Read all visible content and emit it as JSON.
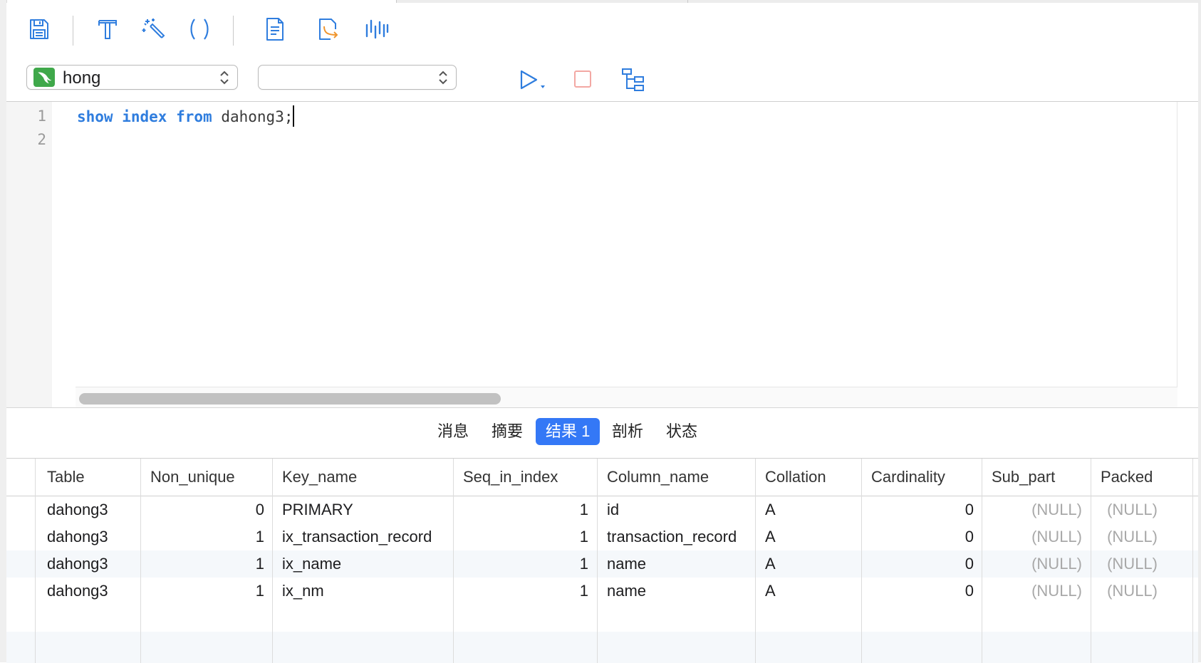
{
  "toolbar": {
    "icons": [
      "save-icon",
      "format-icon",
      "magic-wand-icon",
      "parentheses-icon",
      "document-icon",
      "export-icon",
      "profile-chart-icon"
    ],
    "connection": {
      "value": "hong",
      "icon": "mysql-dolphin-icon"
    },
    "database": {
      "value": ""
    },
    "run_icon": "play-icon",
    "stop_icon": "stop-icon",
    "explain_icon": "explain-tree-icon"
  },
  "editor": {
    "line_numbers": [
      "1",
      "2"
    ],
    "tokens": [
      {
        "text": "show",
        "type": "kw"
      },
      {
        "text": " ",
        "type": "plain"
      },
      {
        "text": "index",
        "type": "kw"
      },
      {
        "text": " ",
        "type": "plain"
      },
      {
        "text": "from",
        "type": "kw"
      },
      {
        "text": " dahong3;",
        "type": "plain"
      }
    ]
  },
  "result_tabs": [
    {
      "label": "消息",
      "active": false
    },
    {
      "label": "摘要",
      "active": false
    },
    {
      "label": "结果 1",
      "active": true
    },
    {
      "label": "剖析",
      "active": false
    },
    {
      "label": "状态",
      "active": false
    }
  ],
  "grid": {
    "columns": [
      "Table",
      "Non_unique",
      "Key_name",
      "Seq_in_index",
      "Column_name",
      "Collation",
      "Cardinality",
      "Sub_part",
      "Packed"
    ],
    "rows": [
      [
        "dahong3",
        "0",
        "PRIMARY",
        "1",
        "id",
        "A",
        "0",
        "(NULL)",
        "(NULL)"
      ],
      [
        "dahong3",
        "1",
        "ix_transaction_record",
        "1",
        "transaction_record",
        "A",
        "0",
        "(NULL)",
        "(NULL)"
      ],
      [
        "dahong3",
        "1",
        "ix_name",
        "1",
        "name",
        "A",
        "0",
        "(NULL)",
        "(NULL)"
      ],
      [
        "dahong3",
        "1",
        "ix_nm",
        "1",
        "name",
        "A",
        "0",
        "(NULL)",
        "(NULL)"
      ]
    ]
  },
  "colors": {
    "accent": "#3478f6",
    "keyword": "#2f7dde",
    "icon_blue": "#2f7dde",
    "icon_orange": "#f0962f",
    "stop": "#f3a8a3",
    "connection_green": "#3fa84a"
  }
}
